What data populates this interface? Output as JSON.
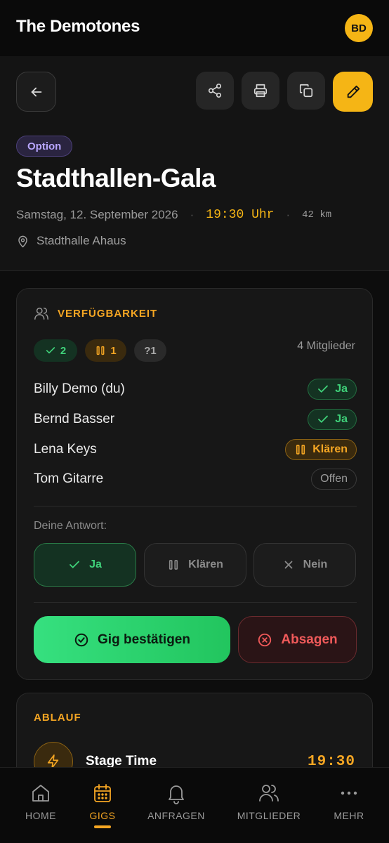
{
  "app": {
    "title": "The Demotones",
    "avatar_initials": "BD"
  },
  "gig": {
    "status": "Option",
    "title": "Stadthallen-Gala",
    "date": "Samstag, 12. September 2026",
    "separator": "·",
    "time": "19:30 Uhr",
    "distance": "42 km",
    "venue": "Stadthalle Ahaus"
  },
  "availability": {
    "title": "VERFÜGBARKEIT",
    "counts": {
      "yes": "2",
      "clarify": "1",
      "open": "?1"
    },
    "member_count": "4 Mitglieder",
    "members": [
      {
        "name": "Billy Demo (du)",
        "status": "Ja"
      },
      {
        "name": "Bernd Basser",
        "status": "Ja"
      },
      {
        "name": "Lena Keys",
        "status": "Klären"
      },
      {
        "name": "Tom Gitarre",
        "status": "Offen"
      }
    ],
    "answer_label": "Deine Antwort:",
    "answers": {
      "yes": "Ja",
      "clarify": "Klären",
      "no": "Nein"
    },
    "confirm_label": "Gig bestätigen",
    "cancel_label": "Absagen"
  },
  "schedule": {
    "title": "ABLAUF",
    "items": [
      {
        "name": "Stage Time",
        "time": "19:30"
      }
    ]
  },
  "nav": {
    "items": [
      {
        "label": "HOME",
        "icon": "home-icon"
      },
      {
        "label": "GIGS",
        "icon": "calendar-icon",
        "active": true
      },
      {
        "label": "ANFRAGEN",
        "icon": "bell-icon"
      },
      {
        "label": "MITGLIEDER",
        "icon": "users-icon"
      },
      {
        "label": "MEHR",
        "icon": "more-icon"
      }
    ]
  },
  "colors": {
    "accent": "#f5a623",
    "success": "#3fd27a",
    "danger": "#f05a5a",
    "option": "#b8a6ff"
  }
}
